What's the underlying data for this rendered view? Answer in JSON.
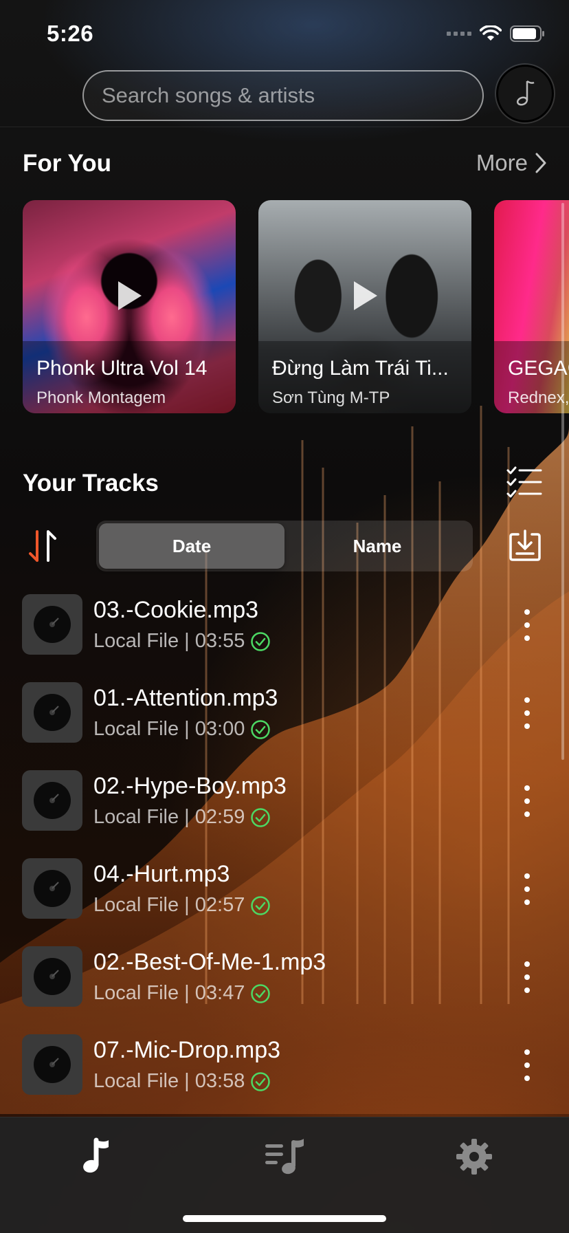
{
  "status_bar": {
    "time": "5:26"
  },
  "search": {
    "placeholder": "Search songs & artists"
  },
  "for_you": {
    "title": "For You",
    "more_label": "More",
    "cards": [
      {
        "title": "Phonk Ultra Vol 14",
        "artist": "Phonk Montagem"
      },
      {
        "title": "Đừng Làm Trái Ti...",
        "artist": "Sơn Tùng M-TP"
      },
      {
        "title": "GEGAC",
        "artist": "Rednex,"
      }
    ]
  },
  "tracks": {
    "title": "Your Tracks",
    "sort_options": [
      "Date",
      "Name"
    ],
    "selected_sort": "Date",
    "items": [
      {
        "name": "03.-Cookie.mp3",
        "source": "Local File | 03:55"
      },
      {
        "name": "01.-Attention.mp3",
        "source": "Local File | 03:00"
      },
      {
        "name": "02.-Hype-Boy.mp3",
        "source": "Local File | 02:59"
      },
      {
        "name": "04.-Hurt.mp3",
        "source": "Local File | 02:57"
      },
      {
        "name": "02.-Best-Of-Me-1.mp3",
        "source": "Local File | 03:47"
      },
      {
        "name": "07.-Mic-Drop.mp3",
        "source": "Local File | 03:58"
      }
    ]
  },
  "tabs": [
    {
      "icon": "music-note-icon",
      "active": true
    },
    {
      "icon": "playlist-icon",
      "active": false
    },
    {
      "icon": "gear-icon",
      "active": false
    }
  ],
  "colors": {
    "accent_orange": "#f0572b",
    "check_green": "#4cd964",
    "tab_inactive": "#8a8a8a"
  }
}
